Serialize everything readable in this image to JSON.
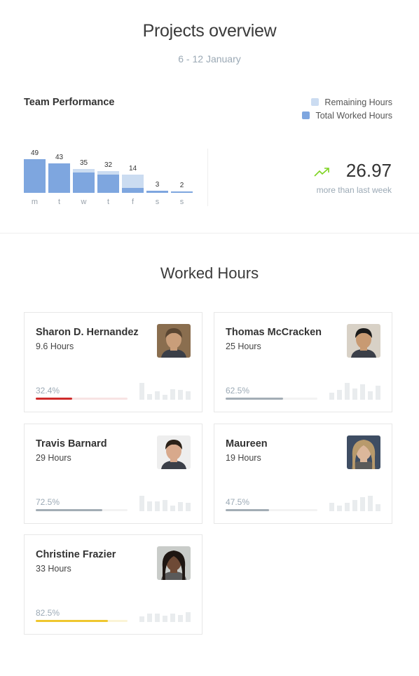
{
  "header": {
    "title": "Projects overview",
    "date_range": "6 - 12 January"
  },
  "team_performance": {
    "title": "Team Performance",
    "legend": [
      {
        "label": "Remaining Hours",
        "color": "#cbdcf1"
      },
      {
        "label": "Total Worked Hours",
        "color": "#7ea6df"
      }
    ]
  },
  "chart_data": {
    "type": "bar",
    "categories": [
      "m",
      "t",
      "w",
      "t",
      "f",
      "s",
      "s"
    ],
    "series": [
      {
        "name": "Total Worked Hours",
        "values": [
          49,
          43,
          30,
          27,
          7,
          3,
          2
        ]
      },
      {
        "name": "Remaining Hours",
        "values": [
          0,
          0,
          5,
          5,
          20,
          0,
          0
        ]
      }
    ],
    "data_labels": [
      "49",
      "43",
      "35",
      "32",
      "14",
      "3",
      "2"
    ],
    "ylim": [
      0,
      60
    ]
  },
  "trend": {
    "value": "26.97",
    "caption": "more than last week",
    "icon": "trending-up-icon",
    "color": "#7ed321"
  },
  "worked_hours": {
    "title": "Worked Hours",
    "people": [
      {
        "name": "Sharon D. Hernandez",
        "hours": "9.6 Hours",
        "percent_label": "32.4%",
        "progress": 0.4,
        "bar_color": "#cf2b2b",
        "track_color": "#f8e3e3",
        "avatar": "man-avatar",
        "avatar_colors": [
          "#8a6e4f",
          "#c99e7a",
          "#5a4632"
        ],
        "spark": [
          24,
          8,
          12,
          7,
          15,
          14,
          12
        ]
      },
      {
        "name": "Thomas McCracken",
        "hours": "25 Hours",
        "percent_label": "62.5%",
        "progress": 0.625,
        "bar_color": "#a3adb5",
        "track_color": "#f3f3f3",
        "avatar": "man-avatar",
        "avatar_colors": [
          "#d8d1c6",
          "#c89a72",
          "#1b1b1b"
        ],
        "spark": [
          10,
          14,
          24,
          16,
          22,
          12,
          20
        ]
      },
      {
        "name": "Travis Barnard",
        "hours": "29 Hours",
        "percent_label": "72.5%",
        "progress": 0.725,
        "bar_color": "#a3adb5",
        "track_color": "#f3f3f3",
        "avatar": "man-avatar",
        "avatar_colors": [
          "#eeeeee",
          "#d8a98c",
          "#2b2118"
        ],
        "spark": [
          22,
          14,
          14,
          16,
          8,
          13,
          12
        ]
      },
      {
        "name": "Maureen",
        "hours": "19 Hours",
        "percent_label": "47.5%",
        "progress": 0.475,
        "bar_color": "#a3adb5",
        "track_color": "#f3f3f3",
        "avatar": "woman-avatar",
        "avatar_colors": [
          "#3e4d63",
          "#dcb79b",
          "#b89a6c"
        ],
        "spark": [
          12,
          8,
          12,
          16,
          20,
          22,
          10
        ]
      },
      {
        "name": "Christine Frazier",
        "hours": "33 Hours",
        "percent_label": "82.5%",
        "progress": 0.79,
        "bar_color": "#efc72f",
        "track_color": "#fbf4d6",
        "avatar": "woman-avatar",
        "avatar_colors": [
          "#c9ccc9",
          "#6e4a36",
          "#1e1612"
        ],
        "spark": [
          8,
          12,
          12,
          9,
          12,
          10,
          14
        ]
      }
    ]
  }
}
